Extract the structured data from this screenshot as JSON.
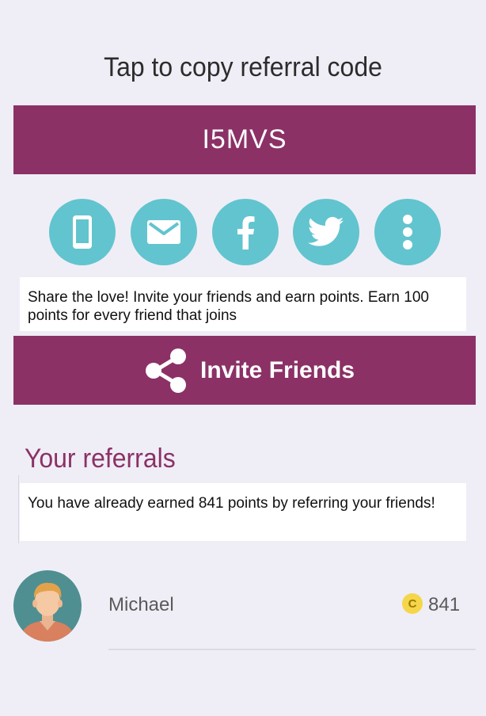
{
  "header": {
    "title": "Tap to copy referral code"
  },
  "referral_code": "I5MVS",
  "share_buttons": [
    {
      "icon": "phone-icon"
    },
    {
      "icon": "email-icon"
    },
    {
      "icon": "facebook-icon"
    },
    {
      "icon": "twitter-icon"
    },
    {
      "icon": "more-vertical-icon"
    }
  ],
  "share_message": "Share the love! Invite your friends and earn points. Earn 100 points for every friend that joins",
  "invite_button": {
    "label": "Invite Friends",
    "icon": "share-icon"
  },
  "referrals_section": {
    "heading": "Your referrals",
    "earned_text": "You have already earned 841 points by referring your friends!"
  },
  "referrals": [
    {
      "name": "Michael",
      "coin_symbol": "C",
      "points": "841"
    }
  ],
  "colors": {
    "brand": "#8b3166",
    "accent": "#62c4cf",
    "background": "#efeef6",
    "coin": "#f5d64a"
  }
}
